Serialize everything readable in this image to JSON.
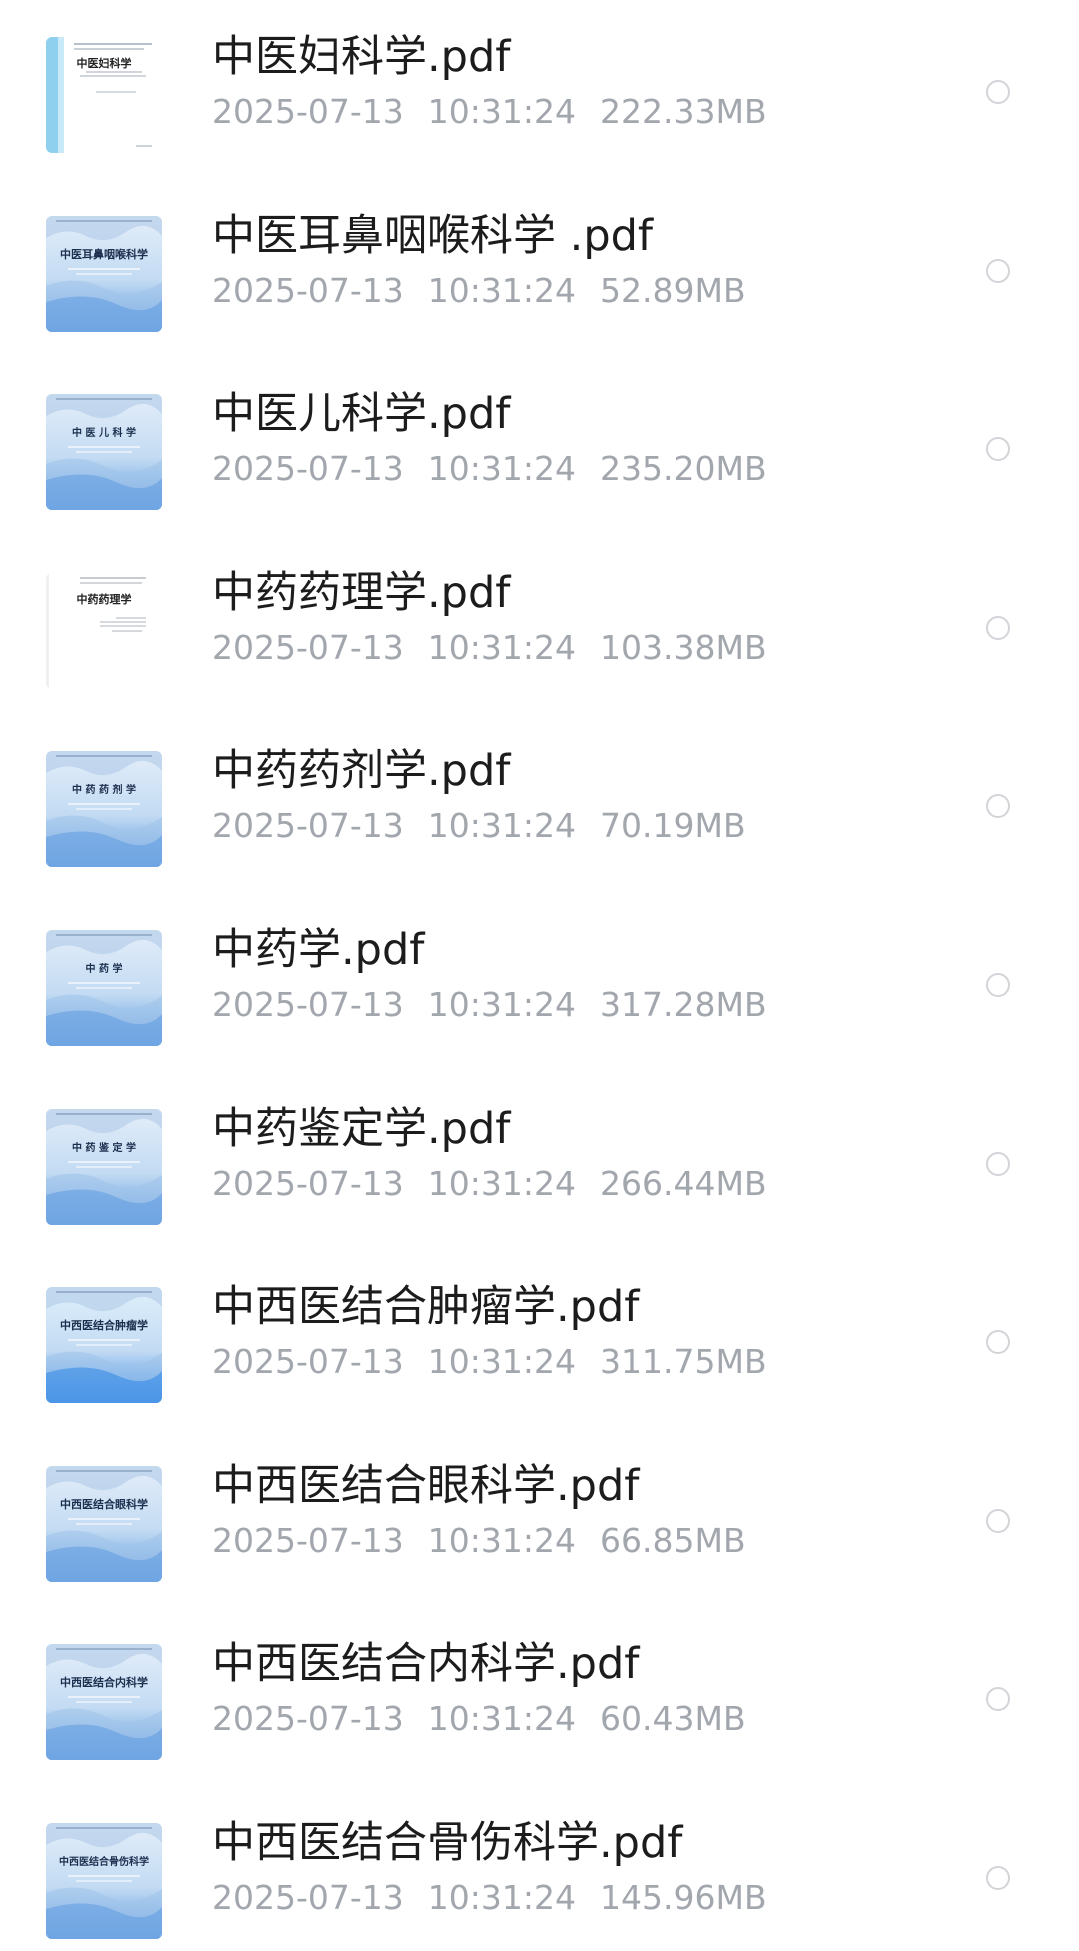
{
  "files": [
    {
      "name": "中医妇科学.pdf",
      "date": "2025-07-13",
      "time": "10:31:24",
      "size": "222.33MB",
      "cover_title": "中医妇科学",
      "cover_style": "white"
    },
    {
      "name": "中医耳鼻咽喉科学 .pdf",
      "date": "2025-07-13",
      "time": "10:31:24",
      "size": "52.89MB",
      "cover_title": "中医耳鼻咽喉科学",
      "cover_style": "blue"
    },
    {
      "name": "中医儿科学.pdf",
      "date": "2025-07-13",
      "time": "10:31:24",
      "size": "235.20MB",
      "cover_title": "中 医 儿 科 学",
      "cover_style": "blue"
    },
    {
      "name": "中药药理学.pdf",
      "date": "2025-07-13",
      "time": "10:31:24",
      "size": "103.38MB",
      "cover_title": "中药药理学",
      "cover_style": "plain"
    },
    {
      "name": "中药药剂学.pdf",
      "date": "2025-07-13",
      "time": "10:31:24",
      "size": "70.19MB",
      "cover_title": "中 药 药 剂 学",
      "cover_style": "blue"
    },
    {
      "name": "中药学.pdf",
      "date": "2025-07-13",
      "time": "10:31:24",
      "size": "317.28MB",
      "cover_title": "中   药   学",
      "cover_style": "blue"
    },
    {
      "name": "中药鉴定学.pdf",
      "date": "2025-07-13",
      "time": "10:31:24",
      "size": "266.44MB",
      "cover_title": "中 药 鉴 定 学",
      "cover_style": "blue"
    },
    {
      "name": "中西医结合肿瘤学.pdf",
      "date": "2025-07-13",
      "time": "10:31:24",
      "size": "311.75MB",
      "cover_title": "中西医结合肿瘤学",
      "cover_style": "bright"
    },
    {
      "name": "中西医结合眼科学.pdf",
      "date": "2025-07-13",
      "time": "10:31:24",
      "size": "66.85MB",
      "cover_title": "中西医结合眼科学",
      "cover_style": "blue"
    },
    {
      "name": "中西医结合内科学.pdf",
      "date": "2025-07-13",
      "time": "10:31:24",
      "size": "60.43MB",
      "cover_title": "中西医结合内科学",
      "cover_style": "blue"
    },
    {
      "name": "中西医结合骨伤科学.pdf",
      "date": "2025-07-13",
      "time": "10:31:24",
      "size": "145.96MB",
      "cover_title": "中西医结合骨伤科学",
      "cover_style": "blue"
    }
  ],
  "colors": {
    "name_text": "#1c1c1c",
    "meta_text": "#a2a6ad",
    "radio_border": "#d2d4d8",
    "cover_blue_top": "#e4eef9",
    "cover_blue_bottom": "#5f9be0"
  }
}
